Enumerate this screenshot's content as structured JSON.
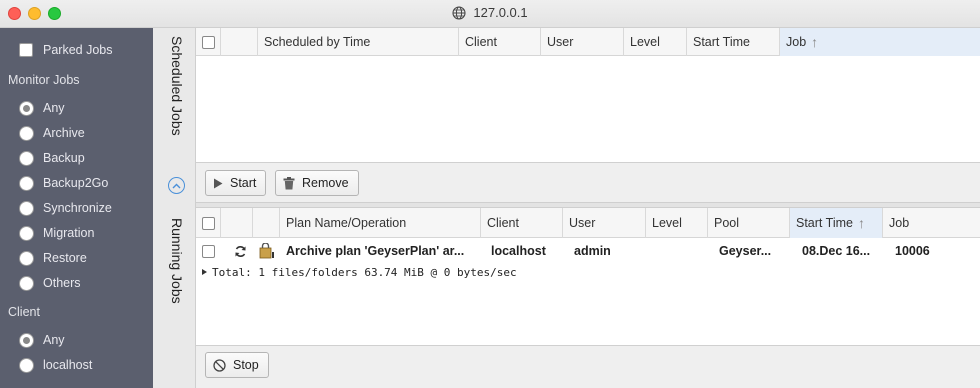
{
  "window": {
    "title": "127.0.0.1"
  },
  "sidebar": {
    "parked_jobs": "Parked Jobs",
    "monitor_heading": "Monitor Jobs",
    "monitor_items": [
      "Any",
      "Archive",
      "Backup",
      "Backup2Go",
      "Synchronize",
      "Migration",
      "Restore",
      "Others"
    ],
    "monitor_selected": "Any",
    "client_heading": "Client",
    "client_items": [
      "Any",
      "localhost"
    ],
    "client_selected": "Any"
  },
  "scheduled": {
    "tab_label": "Scheduled Jobs",
    "columns": [
      "Scheduled by Time",
      "Client",
      "User",
      "Level",
      "Start Time",
      "Job"
    ],
    "sorted_column": "Job",
    "buttons": {
      "start": "Start",
      "remove": "Remove"
    }
  },
  "running": {
    "tab_label": "Running Jobs",
    "columns": [
      "Plan Name/Operation",
      "Client",
      "User",
      "Level",
      "Pool",
      "Start Time",
      "Job"
    ],
    "sorted_column": "Start Time",
    "rows": [
      {
        "plan": "Archive plan 'GeyserPlan' ar...",
        "client": "localhost",
        "user": "admin",
        "level": "",
        "pool": "Geyser...",
        "start_time": "08.Dec 16...",
        "job": "10006"
      }
    ],
    "detail": "Total: 1 files/folders 63.74 MiB @ 0 bytes/sec",
    "buttons": {
      "stop": "Stop"
    }
  },
  "colors": {
    "sidebar_bg": "#5b5f6e",
    "sorted_header": "#e4edf8",
    "accent": "#4a90d9"
  }
}
